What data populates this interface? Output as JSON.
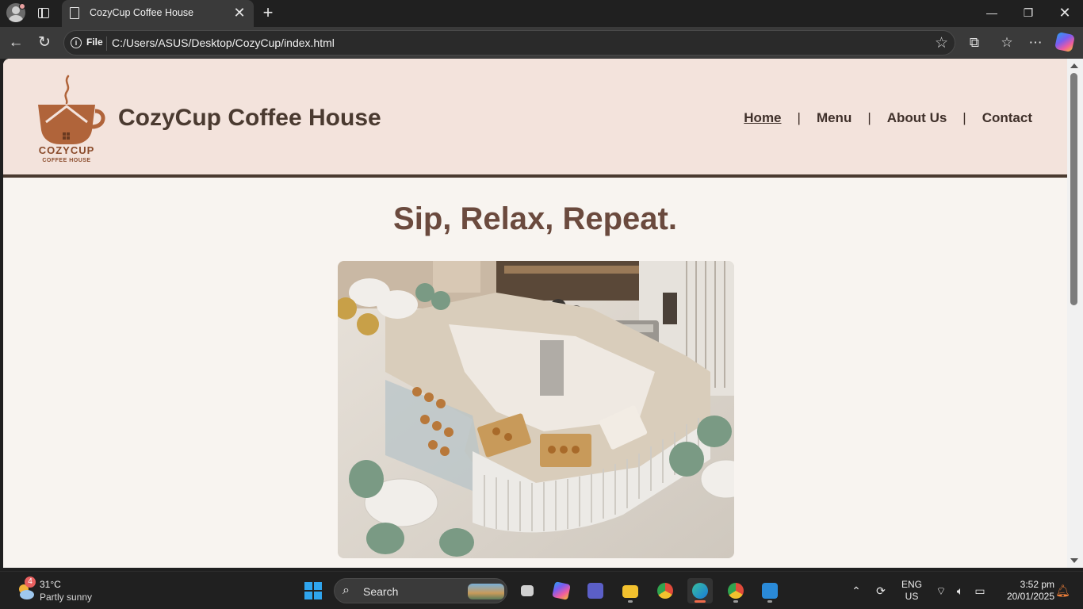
{
  "browser": {
    "tab_title": "CozyCup Coffee House",
    "url_scheme_chip": "File",
    "url": "C:/Users/ASUS/Desktop/CozyCup/index.html"
  },
  "site": {
    "logo_text_main": "COZYCUP",
    "logo_text_sub": "COFFEE HOUSE",
    "title": "CozyCup Coffee House",
    "nav": [
      {
        "label": "Home",
        "active": true
      },
      {
        "label": "Menu",
        "active": false
      },
      {
        "label": "About Us",
        "active": false
      },
      {
        "label": "Contact",
        "active": false
      }
    ],
    "nav_separator": "|",
    "hero_heading": "Sip, Relax, Repeat."
  },
  "colors": {
    "header_bg": "#f3e3dc",
    "page_bg": "#f8f4f0",
    "title_text": "#4a3a30",
    "hero_text": "#6b4a3e",
    "logo_brown": "#b0643a"
  },
  "taskbar": {
    "weather_badge": "4",
    "weather_temp": "31°C",
    "weather_desc": "Partly sunny",
    "search_label": "Search",
    "lang_line1": "ENG",
    "lang_line2": "US",
    "time": "3:52 pm",
    "date": "20/01/2025",
    "apps": [
      "task-view",
      "copilot",
      "teams",
      "file-explorer",
      "chrome",
      "edge",
      "chrome-profile",
      "vscode"
    ]
  }
}
